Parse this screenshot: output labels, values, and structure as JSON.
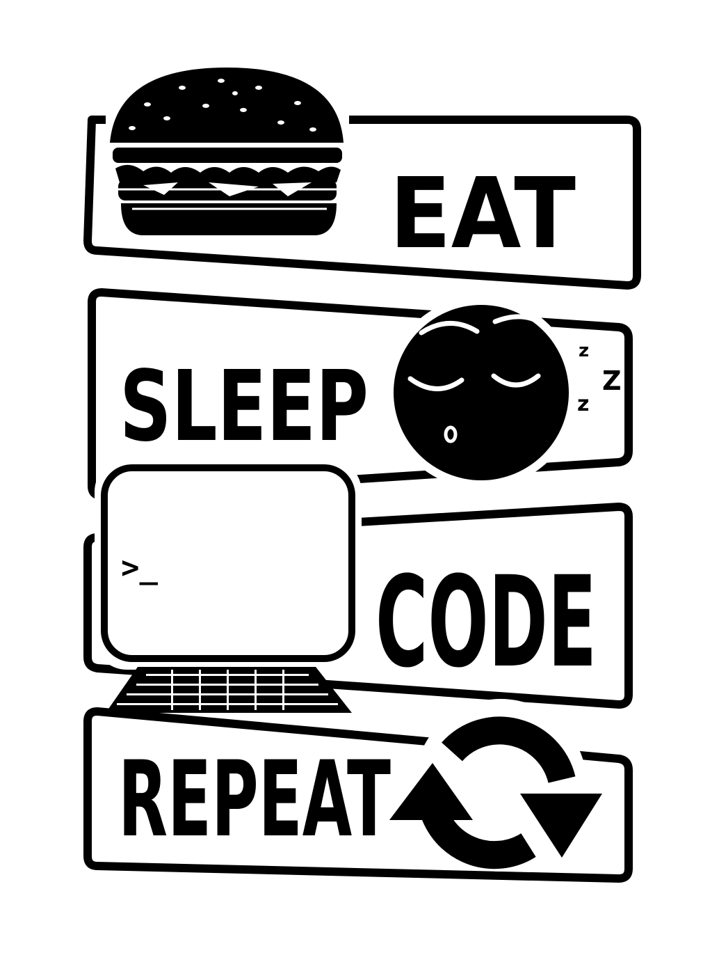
{
  "panels": {
    "eat": {
      "word": "EAT",
      "icon": "burger-icon"
    },
    "sleep": {
      "word": "SLEEP",
      "icon": "sleeping-face-icon",
      "zzz": [
        "z",
        "Z",
        "z"
      ]
    },
    "code": {
      "word": "CODE",
      "icon": "laptop-icon",
      "prompt": ">_"
    },
    "repeat": {
      "word": "REPEAT",
      "icon": "repeat-arrows-icon"
    }
  },
  "colors": {
    "ink": "#000000",
    "paper": "#ffffff"
  }
}
